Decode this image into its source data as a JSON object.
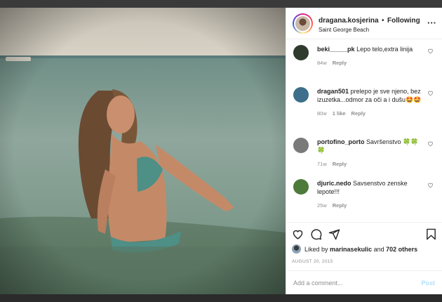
{
  "post": {
    "username": "dragana.kosjerina",
    "separator": "•",
    "follow_status": "Following",
    "location": "Saint George Beach",
    "more_icon": "more-horizontal-icon",
    "more_glyph": "···"
  },
  "comments": [
    {
      "user": "beki_____pk",
      "text": "Lepo telo,extra linija",
      "age": "84w",
      "likes": "",
      "reply": "Reply",
      "avatar_color": "#2f3b2c"
    },
    {
      "user": "dragan501",
      "text": "prelepo je sve njeno, bez izuzetka...odmor za oči a i dušu🤩🤩",
      "age": "80w",
      "likes": "1 like",
      "reply": "Reply",
      "avatar_color": "#3d6e8c"
    },
    {
      "user": "portofino_porto",
      "text": "Savršenstvo 🍀🍀🍀",
      "age": "71w",
      "likes": "",
      "reply": "Reply",
      "avatar_color": "#7a7a7a"
    },
    {
      "user": "djuric.nedo",
      "text": "Savsenstvo zenske lepote!!!",
      "age": "25w",
      "likes": "",
      "reply": "Reply",
      "avatar_color": "#4e7a3a"
    }
  ],
  "actions": {
    "liked_by_prefix": "Liked by",
    "liked_by_user": "marinasekulic",
    "liked_by_and": "and",
    "liked_by_others": "702 others",
    "date": "AUGUST 20, 2015"
  },
  "composer": {
    "placeholder": "Add a comment...",
    "post_label": "Post"
  },
  "colors": {
    "text": "#262626",
    "secondary": "#8e8e8e",
    "post_disabled": "#b2dffc"
  }
}
